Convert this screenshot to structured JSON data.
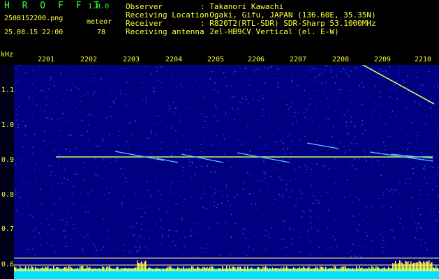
{
  "app": {
    "name": "H R O F F T",
    "version": "1.0.0",
    "filename": "2508152200.png",
    "datetime": "25.08.15 22:00",
    "meteor_label": "meteor",
    "meteor_count": "78"
  },
  "info": [
    {
      "key": "Observer",
      "value": ": Takanori Kawachi"
    },
    {
      "key": "Receiving Location",
      "value": ": Ogaki, Gifu, JAPAN (136.60E, 35.35N)"
    },
    {
      "key": "Receiver",
      "value": ": R820T2(RTL-SDR) SDR-Sharp 53.1000MHz"
    },
    {
      "key": "Receiving antenna",
      "value": ": 2el-HB9CV Vertical (el. E-W)"
    }
  ],
  "axis": {
    "unit": "kHz",
    "time_labels": [
      "2201",
      "2202",
      "2203",
      "2204",
      "2205",
      "2206",
      "2207",
      "2208",
      "2209",
      "2210"
    ],
    "freq_labels": [
      "1.1",
      "1.0",
      "0.9",
      "0.8",
      "0.7",
      "0.6"
    ]
  },
  "colors": {
    "text": "#ffff40",
    "brand": "#40ff40",
    "background": "#000080",
    "carrier": "#c8ff60",
    "meteor": "#60c0ff"
  }
}
